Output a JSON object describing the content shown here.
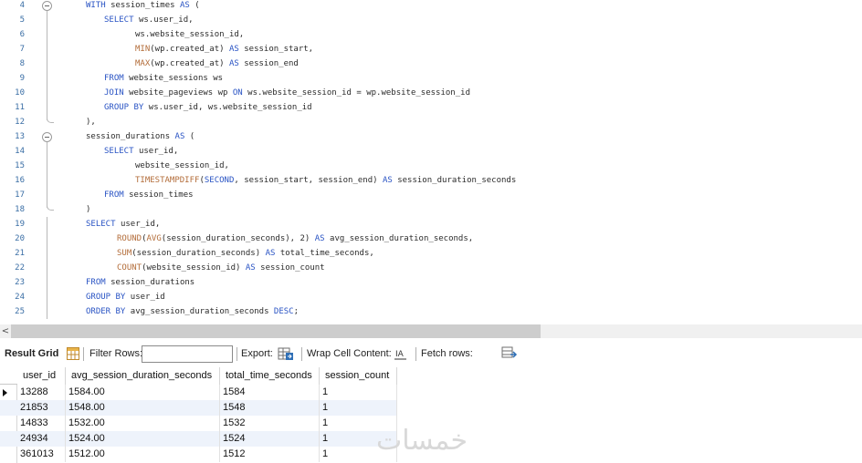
{
  "editor": {
    "lines": [
      {
        "n": "4",
        "indent": 94,
        "fold": "open",
        "parts": [
          [
            "kw",
            "WITH "
          ],
          [
            "t",
            "session_times "
          ],
          [
            "kw",
            "AS"
          ],
          [
            "t",
            " ("
          ]
        ]
      },
      {
        "n": "5",
        "indent": 114,
        "parts": [
          [
            "kw",
            "SELECT "
          ],
          [
            "t",
            "ws.user_id,"
          ]
        ]
      },
      {
        "n": "6",
        "indent": 148,
        "parts": [
          [
            "t",
            "ws.website_session_id,"
          ]
        ]
      },
      {
        "n": "7",
        "indent": 148,
        "parts": [
          [
            "fn",
            "MIN"
          ],
          [
            "t",
            "(wp.created_at) "
          ],
          [
            "kw",
            "AS"
          ],
          [
            "t",
            " session_start,"
          ]
        ]
      },
      {
        "n": "8",
        "indent": 148,
        "parts": [
          [
            "fn",
            "MAX"
          ],
          [
            "t",
            "(wp.created_at) "
          ],
          [
            "kw",
            "AS"
          ],
          [
            "t",
            " session_end"
          ]
        ]
      },
      {
        "n": "9",
        "indent": 114,
        "parts": [
          [
            "kw",
            "FROM "
          ],
          [
            "t",
            "website_sessions ws"
          ]
        ]
      },
      {
        "n": "10",
        "indent": 114,
        "parts": [
          [
            "kw",
            "JOIN "
          ],
          [
            "t",
            "website_pageviews wp "
          ],
          [
            "kw",
            "ON"
          ],
          [
            "t",
            " ws.website_session_id = wp.website_session_id"
          ]
        ]
      },
      {
        "n": "11",
        "indent": 114,
        "parts": [
          [
            "kw",
            "GROUP BY "
          ],
          [
            "t",
            "ws.user_id, ws.website_session_id"
          ]
        ]
      },
      {
        "n": "12",
        "indent": 94,
        "fold": "end",
        "parts": [
          [
            "t",
            "),"
          ]
        ]
      },
      {
        "n": "13",
        "indent": 94,
        "fold": "open",
        "parts": [
          [
            "t",
            "session_durations "
          ],
          [
            "kw",
            "AS"
          ],
          [
            "t",
            " ("
          ]
        ]
      },
      {
        "n": "14",
        "indent": 114,
        "parts": [
          [
            "kw",
            "SELECT "
          ],
          [
            "t",
            "user_id,"
          ]
        ]
      },
      {
        "n": "15",
        "indent": 148,
        "parts": [
          [
            "t",
            "website_session_id,"
          ]
        ]
      },
      {
        "n": "16",
        "indent": 148,
        "parts": [
          [
            "fn",
            "TIMESTAMPDIFF"
          ],
          [
            "t",
            "("
          ],
          [
            "kw",
            "SECOND"
          ],
          [
            "t",
            ", session_start, session_end) "
          ],
          [
            "kw",
            "AS"
          ],
          [
            "t",
            " session_duration_seconds"
          ]
        ]
      },
      {
        "n": "17",
        "indent": 114,
        "parts": [
          [
            "kw",
            "FROM "
          ],
          [
            "t",
            "session_times"
          ]
        ]
      },
      {
        "n": "18",
        "indent": 94,
        "fold": "end",
        "parts": [
          [
            "t",
            ")"
          ]
        ]
      },
      {
        "n": "19",
        "indent": 94,
        "parts": [
          [
            "kw",
            "SELECT "
          ],
          [
            "t",
            "user_id,"
          ]
        ]
      },
      {
        "n": "20",
        "indent": 128,
        "parts": [
          [
            "fn",
            "ROUND"
          ],
          [
            "t",
            "("
          ],
          [
            "fn",
            "AVG"
          ],
          [
            "t",
            "(session_duration_seconds), 2) "
          ],
          [
            "kw",
            "AS"
          ],
          [
            "t",
            " avg_session_duration_seconds,"
          ]
        ]
      },
      {
        "n": "21",
        "indent": 128,
        "parts": [
          [
            "fn",
            "SUM"
          ],
          [
            "t",
            "(session_duration_seconds) "
          ],
          [
            "kw",
            "AS"
          ],
          [
            "t",
            " total_time_seconds,"
          ]
        ]
      },
      {
        "n": "22",
        "indent": 128,
        "parts": [
          [
            "fn",
            "COUNT"
          ],
          [
            "t",
            "(website_session_id) "
          ],
          [
            "kw",
            "AS"
          ],
          [
            "t",
            " session_count"
          ]
        ]
      },
      {
        "n": "23",
        "indent": 94,
        "parts": [
          [
            "kw",
            "FROM "
          ],
          [
            "t",
            "session_durations"
          ]
        ]
      },
      {
        "n": "24",
        "indent": 94,
        "parts": [
          [
            "kw",
            "GROUP BY "
          ],
          [
            "t",
            "user_id"
          ]
        ]
      },
      {
        "n": "25",
        "indent": 94,
        "parts": [
          [
            "kw",
            "ORDER BY "
          ],
          [
            "t",
            "avg_session_duration_seconds "
          ],
          [
            "kw",
            "DESC"
          ],
          [
            "t",
            ";"
          ]
        ]
      }
    ]
  },
  "scrollbar": {
    "left_arrow": "<"
  },
  "toolbar": {
    "result_grid": "Result Grid",
    "filter_rows": "Filter Rows:",
    "filter_value": "",
    "export": "Export:",
    "wrap_cell": "Wrap Cell Content:",
    "fetch_rows": "Fetch rows:"
  },
  "grid": {
    "columns": [
      "user_id",
      "avg_session_duration_seconds",
      "total_time_seconds",
      "session_count"
    ],
    "rows": [
      [
        "13288",
        "1584.00",
        "1584",
        "1"
      ],
      [
        "21853",
        "1548.00",
        "1548",
        "1"
      ],
      [
        "14833",
        "1532.00",
        "1532",
        "1"
      ],
      [
        "24934",
        "1524.00",
        "1524",
        "1"
      ],
      [
        "361013",
        "1512.00",
        "1512",
        "1"
      ]
    ]
  },
  "watermark": "خمسات",
  "colors": {
    "keyword": "#2a54c4",
    "function": "#b36d3a",
    "line_number": "#3a6ea5"
  }
}
